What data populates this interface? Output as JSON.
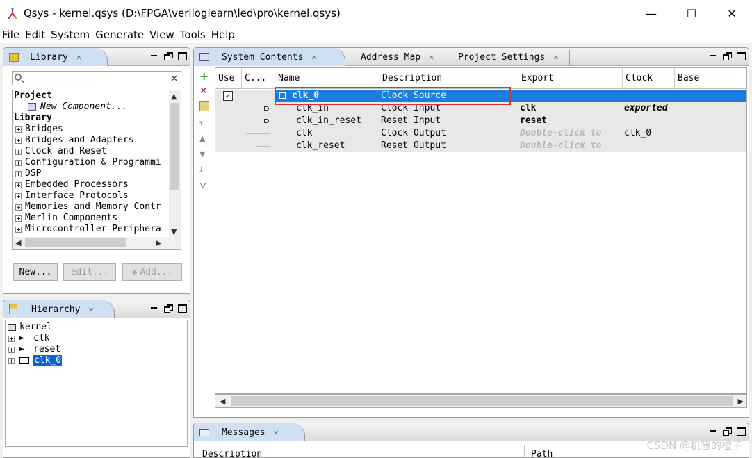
{
  "window": {
    "title": "Qsys - kernel.qsys (D:\\FPGA\\veriloglearn\\led\\pro\\kernel.qsys)",
    "minimize": "—",
    "maximize": "☐",
    "close": "✕"
  },
  "menu": [
    "File",
    "Edit",
    "System",
    "Generate",
    "View",
    "Tools",
    "Help"
  ],
  "library": {
    "tab": "Library",
    "search_placeholder": "",
    "project_header": "Project",
    "new_component": "New Component...",
    "library_header": "Library",
    "items": [
      "Bridges",
      "Bridges and Adapters",
      "Clock and Reset",
      "Configuration & Programmi",
      "DSP",
      "Embedded Processors",
      "Interface Protocols",
      "Memories and Memory Contr",
      "Merlin Components",
      "Microcontroller Periphera"
    ],
    "buttons": {
      "new": "New...",
      "edit": "Edit...",
      "add": "Add..."
    }
  },
  "hierarchy": {
    "tab": "Hierarchy",
    "root": "kernel",
    "items": [
      "clk",
      "reset",
      "clk_0"
    ]
  },
  "tabs": [
    "System Contents",
    "Address Map",
    "Project Settings"
  ],
  "table": {
    "headers": {
      "use": "Use",
      "connections": "C...",
      "name": "Name",
      "description": "Description",
      "export": "Export",
      "clock": "Clock",
      "base": "Base"
    },
    "rows": [
      {
        "name": "clk_0",
        "description": "Clock Source",
        "export": "",
        "clock": ""
      },
      {
        "name": "clk_in",
        "description": "Clock Input",
        "export": "clk",
        "clock": "exported"
      },
      {
        "name": "clk_in_reset",
        "description": "Reset Input",
        "export": "reset",
        "clock": ""
      },
      {
        "name": "clk",
        "description": "Clock Output",
        "export": "Double-click to",
        "clock": "clk_0"
      },
      {
        "name": "clk_reset",
        "description": "Reset Output",
        "export": "Double-click to",
        "clock": ""
      }
    ]
  },
  "messages": {
    "tab": "Messages",
    "headers": {
      "description": "Description",
      "path": "Path"
    }
  },
  "watermark": "CSDN @机智的橙子"
}
